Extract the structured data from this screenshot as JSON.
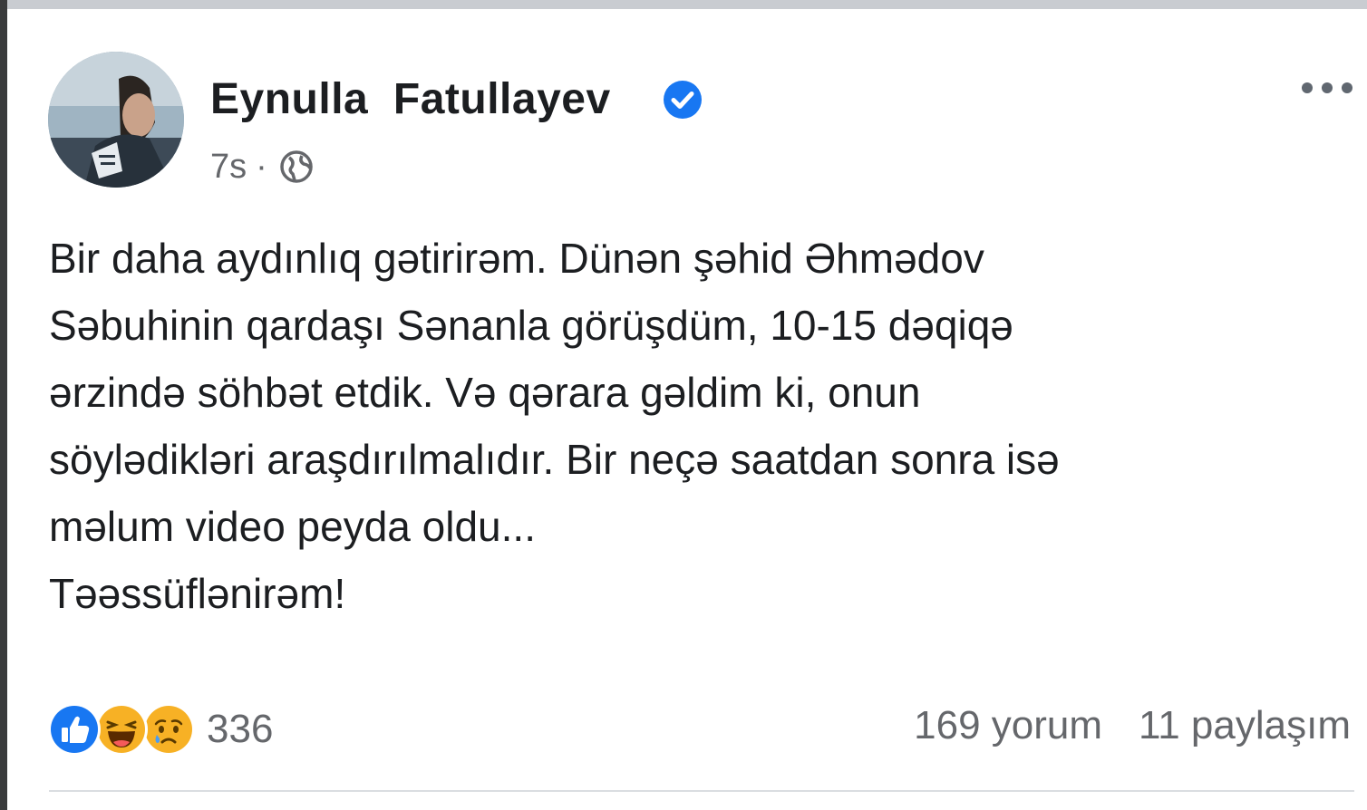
{
  "post": {
    "author": "Eynulla  Fatullayev",
    "time": "7s",
    "separator": "·",
    "privacy_icon": "globe-icon",
    "verified_icon": "verified-badge-icon",
    "lines": [
      "Bir daha aydınlıq gətirirəm. Dünən şəhid Əhmədov",
      "Səbuhinin qardaşı Sənanla görüşdüm, 10-15 dəqiqə",
      "ərzində söhbət etdik. Və qərara gəldim ki, onun",
      "söylədikləri araşdırılmalıdır. Bir neçə saatdan sonra isə",
      "məlum video peyda oldu...",
      "Təəssüflənirəm!"
    ]
  },
  "reactions": {
    "icons": [
      "like-icon",
      "haha-icon",
      "sad-icon"
    ],
    "count": "336"
  },
  "stats": {
    "comments": "169 yorum",
    "shares": "11 paylaşım"
  },
  "colors": {
    "accent": "#1877f2",
    "text": "#1c1e21",
    "secondary_text": "#65676b",
    "reaction_yellow": "#f7b125"
  }
}
